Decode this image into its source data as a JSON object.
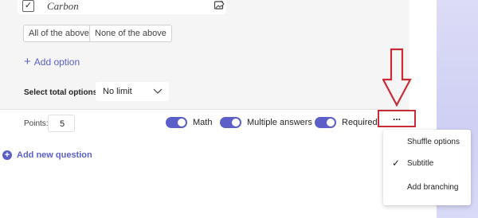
{
  "question": {
    "option_text": "Carbon",
    "chips": [
      "All of the above",
      "None of the above"
    ],
    "add_option_label": "Add option",
    "total_options_label": "Select total options:",
    "total_options_value": "No limit"
  },
  "footer": {
    "points_label": "Points:",
    "points_value": "5",
    "toggles": [
      {
        "label": "Math",
        "on": true
      },
      {
        "label": "Multiple answers",
        "on": true
      },
      {
        "label": "Required",
        "on": true
      }
    ],
    "more_label": "...",
    "add_question_label": "Add new question"
  },
  "menu": {
    "items": [
      {
        "label": "Shuffle options",
        "checked": false
      },
      {
        "label": "Subtitle",
        "checked": true
      },
      {
        "label": "Add branching",
        "checked": false
      }
    ]
  },
  "colors": {
    "accent": "#5b5fc7",
    "highlight": "#c82d36"
  }
}
